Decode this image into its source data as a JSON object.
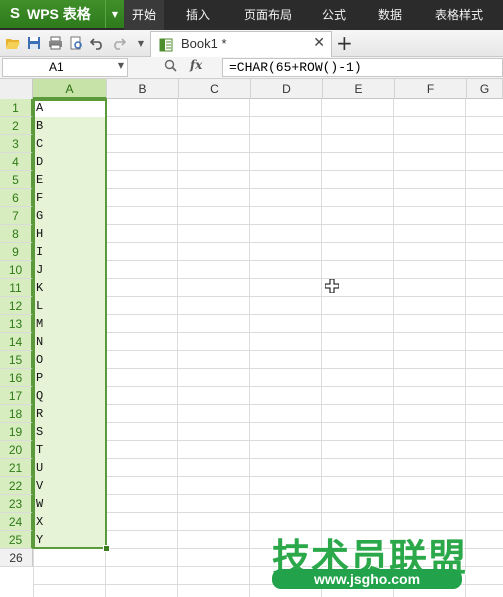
{
  "app": {
    "title": "WPS 表格",
    "logo_glyph": "S"
  },
  "menu": {
    "tabs": [
      {
        "label": "开始",
        "active": true
      },
      {
        "label": "插入",
        "active": false
      },
      {
        "label": "页面布局",
        "active": false
      },
      {
        "label": "公式",
        "active": false
      },
      {
        "label": "数据",
        "active": false
      },
      {
        "label": "表格样式",
        "active": false
      }
    ]
  },
  "document_tab": {
    "label": "Book1 *"
  },
  "formula_bar": {
    "name_box": "A1",
    "fx_label": "fx",
    "formula": "=CHAR(65+ROW()-1)"
  },
  "sheet": {
    "columns": [
      "A",
      "B",
      "C",
      "D",
      "E",
      "F",
      "G"
    ],
    "selected_column": "A",
    "rows": [
      "1",
      "2",
      "3",
      "4",
      "5",
      "6",
      "7",
      "8",
      "9",
      "10",
      "11",
      "12",
      "13",
      "14",
      "15",
      "16",
      "17",
      "18",
      "19",
      "20",
      "21",
      "22",
      "23",
      "24",
      "25",
      "26"
    ],
    "column_a_values": [
      "A",
      "B",
      "C",
      "D",
      "E",
      "F",
      "G",
      "H",
      "I",
      "J",
      "K",
      "L",
      "M",
      "N",
      "O",
      "P",
      "Q",
      "R",
      "S",
      "T",
      "U",
      "V",
      "W",
      "X",
      "Y"
    ]
  },
  "watermark": {
    "chinese": "技术员联盟",
    "url": "www.jsgho.com"
  },
  "colors": {
    "accent_green": "#2e7a1c",
    "selection_fill": "#e6f3d7",
    "selection_border": "#5a9a3a"
  }
}
